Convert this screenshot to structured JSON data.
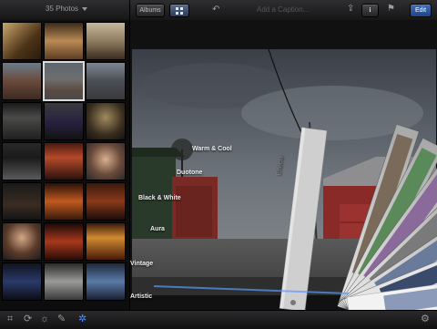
{
  "topbar": {
    "album_title": "35 Photos",
    "albums_label": "Albums",
    "caption_placeholder": "Add a Caption...",
    "edit_label": "Edit"
  },
  "colors": {
    "accent": "#4d90ff",
    "edit_button": "#2f5fa8"
  },
  "icons": {
    "grid": "grid-icon",
    "undo": "undo-icon",
    "share": "share-icon",
    "info": "info-icon",
    "flag": "flag-icon",
    "settings": "gear-icon"
  },
  "effects": {
    "tab_label": "Effects",
    "options": [
      "Warm & Cool",
      "Duotone",
      "Black & White",
      "Aura",
      "Vintage",
      "Artistic"
    ],
    "selected": "Artistic"
  },
  "bottom_tools": [
    "crop-icon",
    "rotate-icon",
    "adjust-icon",
    "brush-icon",
    "effects-icon"
  ],
  "active_tool": "effects-icon"
}
